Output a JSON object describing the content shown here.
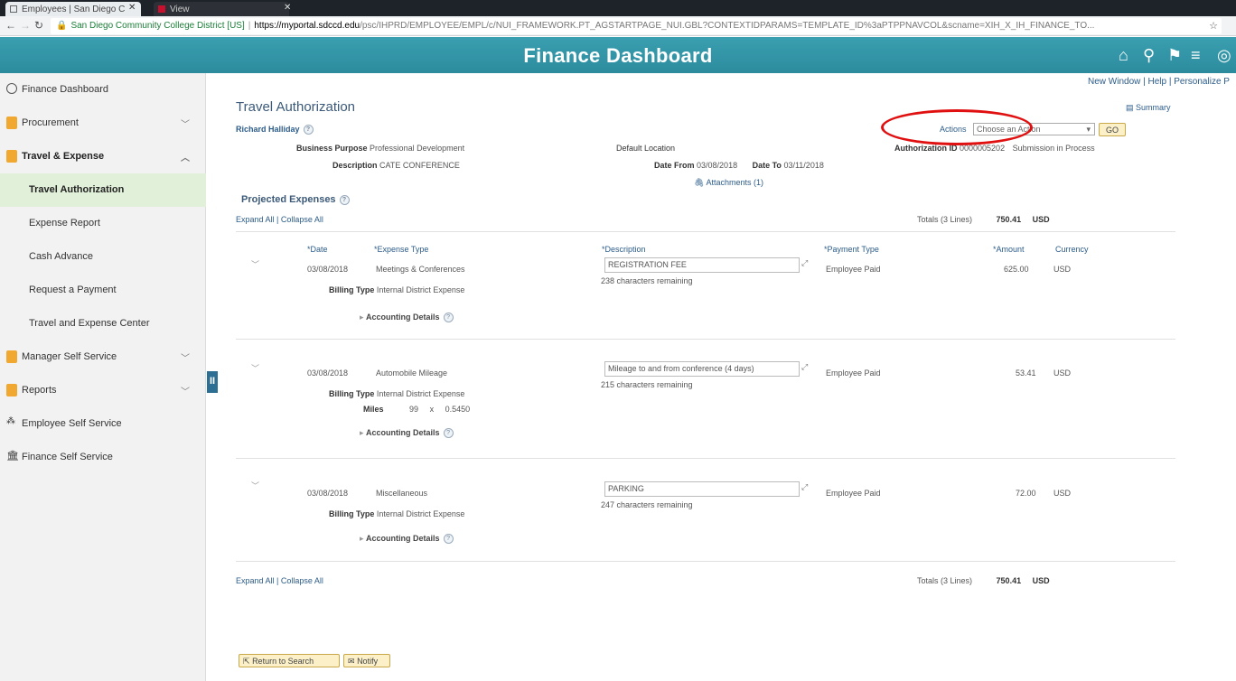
{
  "browser": {
    "tabs": [
      {
        "label": "Employees | San Diego C"
      },
      {
        "label": "View"
      }
    ],
    "url_org": "San Diego Community College District [US]",
    "url_host": "https://myportal.sdccd.edu",
    "url_path": "/psc/IHPRD/EMPLOYEE/EMPL/c/NUI_FRAMEWORK.PT_AGSTARTPAGE_NUI.GBL?CONTEXTIDPARAMS=TEMPLATE_ID%3aPTPPNAVCOL&scname=XIH_X_IH_FINANCE_TO..."
  },
  "header": {
    "title": "Finance Dashboard"
  },
  "sidebar": {
    "items": [
      {
        "label": "Finance Dashboard"
      },
      {
        "label": "Procurement"
      },
      {
        "label": "Travel & Expense"
      },
      {
        "label": "Travel Authorization"
      },
      {
        "label": "Expense Report"
      },
      {
        "label": "Cash Advance"
      },
      {
        "label": "Request a Payment"
      },
      {
        "label": "Travel and Expense Center"
      },
      {
        "label": "Manager Self Service"
      },
      {
        "label": "Reports"
      },
      {
        "label": "Employee Self Service"
      },
      {
        "label": "Finance Self Service"
      }
    ]
  },
  "toplinks": {
    "new_window": "New Window",
    "help": "Help",
    "personalize": "Personalize P"
  },
  "page": {
    "title": "Travel Authorization",
    "summary": "Summary",
    "employee": "Richard Halliday",
    "actions_label": "Actions",
    "actions_value": "Choose an Action",
    "go": "GO",
    "business_purpose_label": "Business Purpose",
    "business_purpose": "Professional Development",
    "description_label": "Description",
    "description": "CATE CONFERENCE",
    "default_location": "Default Location",
    "date_from_label": "Date From",
    "date_from": "03/08/2018",
    "date_to_label": "Date To",
    "date_to": "03/11/2018",
    "attachments": "Attachments (1)",
    "auth_id_label": "Authorization ID",
    "auth_id": "0000005202",
    "status": "Submission in Process",
    "projected_expenses": "Projected Expenses",
    "expand_all": "Expand All",
    "collapse_all": "Collapse All",
    "totals_label": "Totals (3 Lines)",
    "totals_amount": "750.41",
    "totals_currency": "USD",
    "col_date": "*Date",
    "col_type": "*Expense Type",
    "col_desc": "*Description",
    "col_payment": "*Payment Type",
    "col_amount": "*Amount",
    "col_currency": "Currency",
    "billing_type_label": "Billing Type",
    "accounting_details": "Accounting Details",
    "miles_label": "Miles",
    "miles": "99",
    "miles_x": "x",
    "miles_rate": "0.5450",
    "return_to_search": "Return to Search",
    "notify": "Notify"
  },
  "expenses": [
    {
      "date": "03/08/2018",
      "type": "Meetings & Conferences",
      "description": "REGISTRATION FEE",
      "remaining": "238 characters remaining",
      "payment": "Employee Paid",
      "amount": "625.00",
      "currency": "USD",
      "billing": "Internal District Expense"
    },
    {
      "date": "03/08/2018",
      "type": "Automobile Mileage",
      "description": "Mileage to and from conference (4 days)",
      "remaining": "215 characters remaining",
      "payment": "Employee Paid",
      "amount": "53.41",
      "currency": "USD",
      "billing": "Internal District Expense"
    },
    {
      "date": "03/08/2018",
      "type": "Miscellaneous",
      "description": "PARKING",
      "remaining": "247 characters remaining",
      "payment": "Employee Paid",
      "amount": "72.00",
      "currency": "USD",
      "billing": "Internal District Expense"
    }
  ],
  "colors": {
    "banner": "#2c8c9e",
    "active_nav": "#e1f0d8",
    "highlight_circle": "#e01010"
  }
}
